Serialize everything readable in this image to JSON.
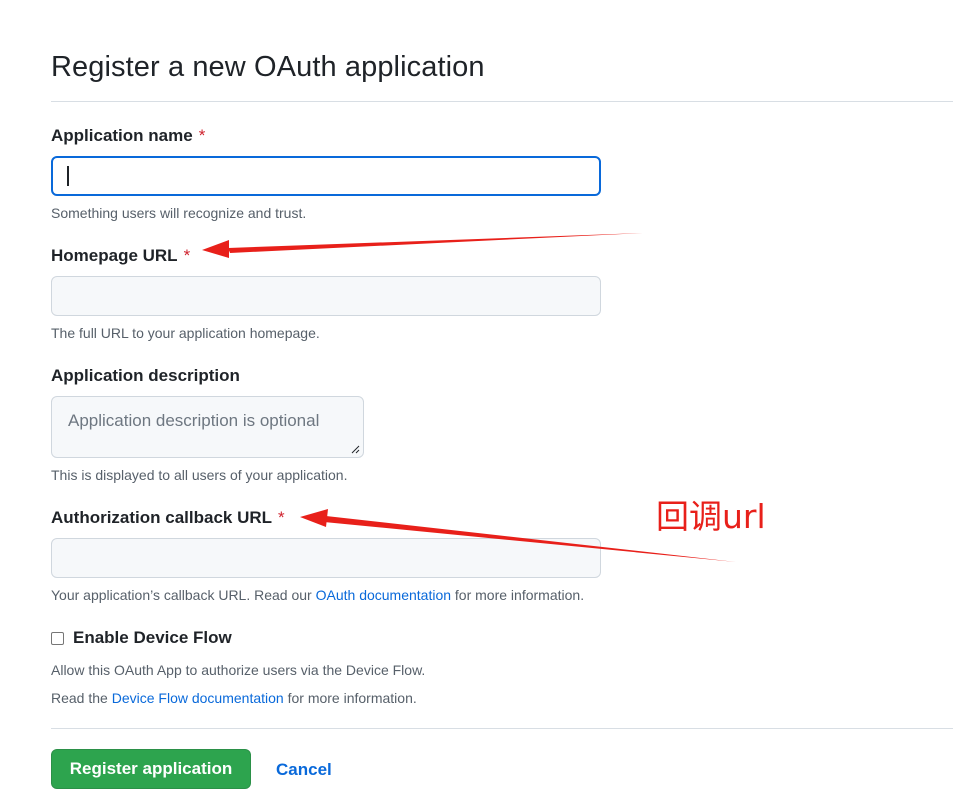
{
  "page": {
    "title": "Register a new OAuth application"
  },
  "form": {
    "app_name": {
      "label": "Application name",
      "required_mark": "*",
      "value": "",
      "note": "Something users will recognize and trust."
    },
    "homepage_url": {
      "label": "Homepage URL",
      "required_mark": "*",
      "value": "",
      "note": "The full URL to your application homepage."
    },
    "description": {
      "label": "Application description",
      "placeholder": "Application description is optional",
      "note": "This is displayed to all users of your application."
    },
    "callback_url": {
      "label": "Authorization callback URL",
      "required_mark": "*",
      "value": "",
      "note_before": "Your application’s callback URL. Read our ",
      "note_link": "OAuth documentation",
      "note_after": " for more information."
    },
    "device_flow": {
      "label": "Enable Device Flow",
      "checked": false,
      "note1": "Allow this OAuth App to authorize users via the Device Flow.",
      "note2_before": "Read the ",
      "note2_link": "Device Flow documentation",
      "note2_after": " for more information."
    }
  },
  "actions": {
    "register_label": "Register application",
    "cancel_label": "Cancel"
  },
  "annotations": {
    "callout_text": "回调url",
    "arrow_color": "#e8201a"
  }
}
